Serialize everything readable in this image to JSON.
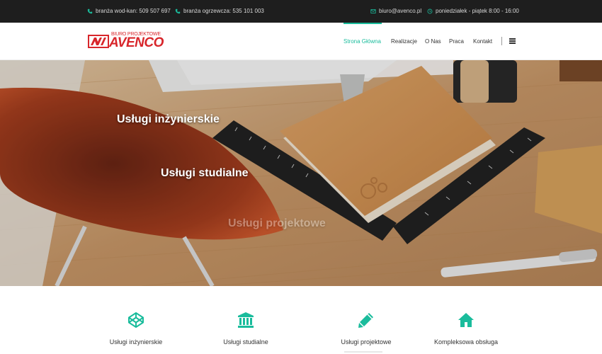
{
  "topbar": {
    "phone1": "branża wod-kan: 509 507 697",
    "phone2": "branża ogrzewcza: 535 101 003",
    "email": "biuro@avenco.pl",
    "hours": "poniedziałek - piątek 8:00 - 16:00",
    "icons": [
      "phone-icon",
      "phone-icon",
      "envelope-icon",
      "clock-icon"
    ]
  },
  "logo": {
    "small_text": "BIURO PROJEKTOWE",
    "big_text": "AVENCO"
  },
  "nav": {
    "items": [
      {
        "label": "Strona Główna",
        "active": true
      },
      {
        "label": "Realizacje",
        "active": false
      },
      {
        "label": "O Nas",
        "active": false
      },
      {
        "label": "Praca",
        "active": false
      },
      {
        "label": "Kontakt",
        "active": false
      }
    ],
    "menu_icon": "hamburger-icon"
  },
  "hero": {
    "lines": [
      "Usługi inżynierskie",
      "Usługi studialne",
      "Usługi projektowe"
    ]
  },
  "services": [
    {
      "label": "Usługi inżynierskie",
      "icon": "codepen-cube-icon"
    },
    {
      "label": "Usługi studialne",
      "icon": "institution-icon"
    },
    {
      "label": "Usługi projektowe",
      "icon": "pencil-icon"
    },
    {
      "label": "Kompleksowa obsługa",
      "icon": "home-icon"
    }
  ],
  "colors": {
    "accent": "#1abc9c",
    "brand": "#d8262b",
    "topbar_bg": "#1e1e1e"
  }
}
